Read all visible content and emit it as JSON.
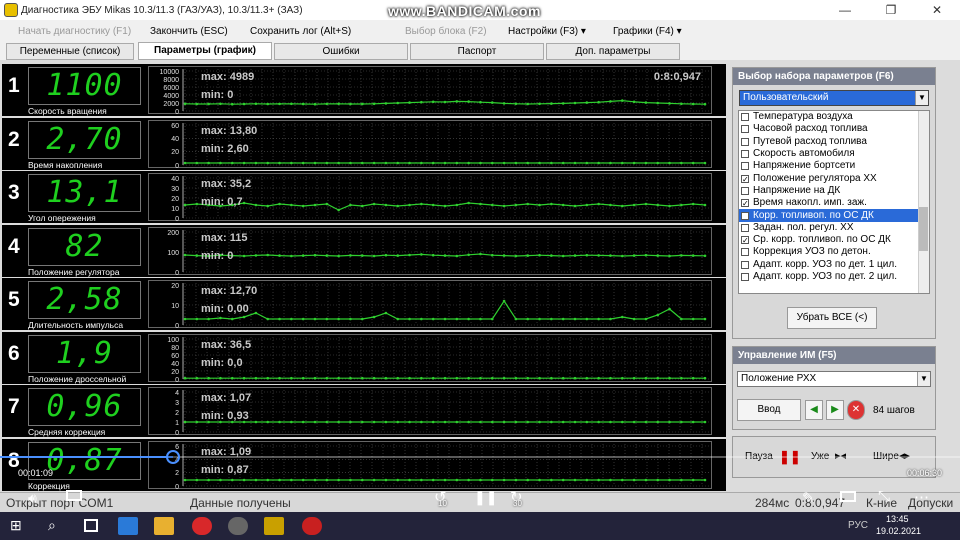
{
  "window": {
    "title": "Диагностика ЭБУ Mikas 10.3/11.3 (ГАЗ/УАЗ), 10.3/11.3+ (ЗАЗ)",
    "watermark": "www.BANDICAM.com",
    "min_glyph": "—",
    "max_glyph": "❐",
    "close_glyph": "✕"
  },
  "menu": {
    "start": "Начать диагностику (F1)",
    "stop": "Закончить (ESC)",
    "save": "Сохранить лог (Alt+S)",
    "block": "Выбор блока (F2)",
    "settings": "Настройки (F3) ▾",
    "graphs": "Графики (F4) ▾"
  },
  "tabs": [
    "Переменные (список)",
    "Параметры (график)",
    "Ошибки",
    "Паспорт",
    "Доп. параметры"
  ],
  "rows": [
    {
      "num": "1",
      "value": "1100",
      "label": "Скорость вращения",
      "max": "max: 4989",
      "min": "min: 0",
      "time": "0:8:0,947",
      "ticks": [
        "10000",
        "8000",
        "6000",
        "4000",
        "2000",
        "0"
      ],
      "series": [
        1800,
        1750,
        1760,
        1800,
        1700,
        1750,
        1800,
        1750,
        1780,
        1800,
        1760,
        1700,
        1780,
        1800,
        1750,
        1760,
        1800,
        1900,
        2000,
        2100,
        2200,
        2300,
        2250,
        2400,
        2350,
        2200,
        2100,
        1900,
        1800,
        1750,
        1800,
        1850,
        1900,
        2000,
        2100,
        2200,
        2400,
        2600,
        2300,
        2100,
        2000,
        1900,
        1800,
        1750,
        1700
      ]
    },
    {
      "num": "2",
      "value": "2,70",
      "label": "Время накопления",
      "max": "max: 13,80",
      "min": "min: 2,60",
      "ticks": [
        "60",
        "40",
        "20",
        "0"
      ],
      "series": [
        3,
        3,
        3,
        3,
        3,
        3,
        3,
        3,
        3,
        3,
        3,
        3,
        3,
        3,
        3,
        3,
        3,
        3,
        3,
        3,
        3,
        3,
        3,
        3,
        3,
        3,
        3,
        3,
        3,
        3,
        3,
        3,
        3,
        3,
        3,
        3,
        3,
        3,
        3,
        3,
        3,
        3,
        3,
        3,
        3
      ]
    },
    {
      "num": "3",
      "value": "13,1",
      "label": "Угол опережения",
      "max": "max: 35,2",
      "min": "min: 0,7",
      "ticks": [
        "40",
        "30",
        "20",
        "10",
        "0"
      ],
      "series": [
        13,
        14,
        13,
        12,
        13,
        15,
        13,
        12,
        14,
        13,
        12,
        13,
        14,
        8,
        13,
        12,
        14,
        13,
        12,
        13,
        14,
        13,
        12,
        13,
        15,
        14,
        13,
        12,
        13,
        14,
        13,
        14,
        13,
        12,
        13,
        14,
        13,
        12,
        13,
        14,
        13,
        12,
        13,
        14,
        13
      ]
    },
    {
      "num": "4",
      "value": "82",
      "label": "Положение регулятора",
      "max": "max: 115",
      "min": "min: 0",
      "ticks": [
        "200",
        "100",
        "0"
      ],
      "series": [
        85,
        82,
        80,
        84,
        82,
        80,
        83,
        85,
        82,
        80,
        82,
        84,
        82,
        80,
        83,
        82,
        80,
        84,
        82,
        85,
        88,
        84,
        82,
        80,
        86,
        90,
        84,
        82,
        80,
        82,
        84,
        82,
        80,
        82,
        84,
        83,
        82,
        80,
        82,
        84,
        82,
        80,
        83,
        82,
        81
      ]
    },
    {
      "num": "5",
      "value": "2,58",
      "label": "Длительность импульса",
      "max": "max: 12,70",
      "min": "min: 0,00",
      "ticks": [
        "20",
        "10",
        "0"
      ],
      "series": [
        3,
        3,
        3,
        3.5,
        3,
        4,
        6,
        3,
        3,
        3,
        3,
        3,
        3,
        3,
        3,
        3,
        4,
        6,
        3,
        3,
        3,
        3,
        3,
        3,
        3,
        3,
        3,
        12,
        3,
        3,
        3,
        3,
        3,
        3,
        3,
        3,
        3,
        4,
        3,
        3,
        5,
        8,
        3,
        3,
        3
      ]
    },
    {
      "num": "6",
      "value": "1,9",
      "label": "Положение дроссельной",
      "max": "max: 36,5",
      "min": "min: 0,0",
      "ticks": [
        "100",
        "80",
        "60",
        "40",
        "20",
        "0"
      ],
      "series": [
        2,
        2,
        2,
        2,
        2,
        2,
        2,
        2,
        2,
        2,
        2,
        2,
        2,
        2,
        2,
        2,
        2,
        2,
        2,
        2,
        2,
        2,
        2,
        2,
        2,
        2,
        2,
        2,
        2,
        2,
        2,
        2,
        2,
        2,
        2,
        2,
        2,
        2,
        2,
        2,
        2,
        2,
        2,
        2,
        2
      ]
    },
    {
      "num": "7",
      "value": "0,96",
      "label": "Средняя коррекция",
      "max": "max: 1,07",
      "min": "min: 0,93",
      "ticks": [
        "4",
        "3",
        "2",
        "1",
        "0"
      ],
      "series": [
        1,
        1,
        1,
        1,
        1,
        1,
        1,
        1,
        1,
        1,
        1,
        1,
        1,
        1,
        1,
        1,
        1,
        1,
        1,
        1,
        1,
        1,
        1,
        1,
        1,
        1,
        1,
        1,
        1,
        1,
        1,
        1,
        1,
        1,
        1,
        1,
        1,
        1,
        1,
        1,
        1,
        1,
        1,
        1,
        1
      ]
    },
    {
      "num": "8",
      "value": "0,87",
      "label": "Коррекция",
      "max": "max: 1,09",
      "min": "min: 0,87",
      "ticks": [
        "6",
        "4",
        "2",
        "0"
      ],
      "series": [
        0.9,
        0.9,
        0.9,
        0.9,
        0.9,
        0.9,
        0.9,
        0.9,
        0.9,
        0.9,
        0.9,
        0.9,
        0.9,
        0.9,
        0.9,
        0.9,
        0.9,
        0.9,
        0.9,
        0.9,
        0.9,
        0.9,
        0.9,
        0.9,
        0.9,
        0.9,
        0.9,
        0.9,
        0.9,
        0.9,
        0.9,
        0.9,
        0.9,
        0.9,
        0.9,
        0.9,
        0.9,
        0.9,
        0.9,
        0.9,
        0.9,
        0.9,
        0.9,
        0.9,
        0.9
      ]
    }
  ],
  "ranges": [
    [
      0,
      10000
    ],
    [
      0,
      60
    ],
    [
      0,
      40
    ],
    [
      0,
      200
    ],
    [
      0,
      20
    ],
    [
      0,
      100
    ],
    [
      0,
      4
    ],
    [
      0,
      6
    ]
  ],
  "paramset": {
    "header": "Выбор набора параметров (F6)",
    "selected": "Пользовательский",
    "items": [
      {
        "label": "Температура воздуха",
        "checked": false
      },
      {
        "label": "Часовой расход топлива",
        "checked": false
      },
      {
        "label": "Путевой расход топлива",
        "checked": false
      },
      {
        "label": "Скорость автомобиля",
        "checked": false
      },
      {
        "label": "Напряжение бортсети",
        "checked": false
      },
      {
        "label": "Положение регулятора ХХ",
        "checked": true
      },
      {
        "label": "Напряжение на ДК",
        "checked": false
      },
      {
        "label": "Время накопл. имп. заж.",
        "checked": true
      },
      {
        "label": "Корр. топливоп. по ОС ДК",
        "checked": true,
        "highlight": true
      },
      {
        "label": "Задан. пол. регул. ХХ",
        "checked": false
      },
      {
        "label": "Ср. корр. топливоп. по ОС ДК",
        "checked": true
      },
      {
        "label": "Коррекция УОЗ по детон.",
        "checked": false
      },
      {
        "label": "Адапт. корр. УОЗ по дет. 1 цил.",
        "checked": false
      },
      {
        "label": "Адапт. корр. УОЗ по дет. 2 цил.",
        "checked": false
      }
    ],
    "clear_all": "Убрать ВСЕ (<)"
  },
  "im": {
    "header": "Управление ИМ (F5)",
    "selected": "Положение РХХ",
    "enter": "Ввод",
    "steps": "84 шагов"
  },
  "playback": {
    "pause": "Пауза",
    "narrow": "Уже",
    "wide": "Шире"
  },
  "status": {
    "port": "Открыт порт COM1",
    "data": "Данные получены",
    "ms": "284мс",
    "time": "0:8:0,947",
    "clear": "К-ние",
    "tol": "Допуски"
  },
  "player": {
    "current": "00:01:09",
    "total": "00:06:30",
    "back": "10",
    "fwd": "30",
    "progress": 0.18
  },
  "tray": {
    "lang": "РУС",
    "clock": "13:45",
    "date": "19.02.2021"
  },
  "colors": {
    "lcd": "#1fd01f",
    "trace": "#2fd02f",
    "accent": "#2a6ad8"
  }
}
